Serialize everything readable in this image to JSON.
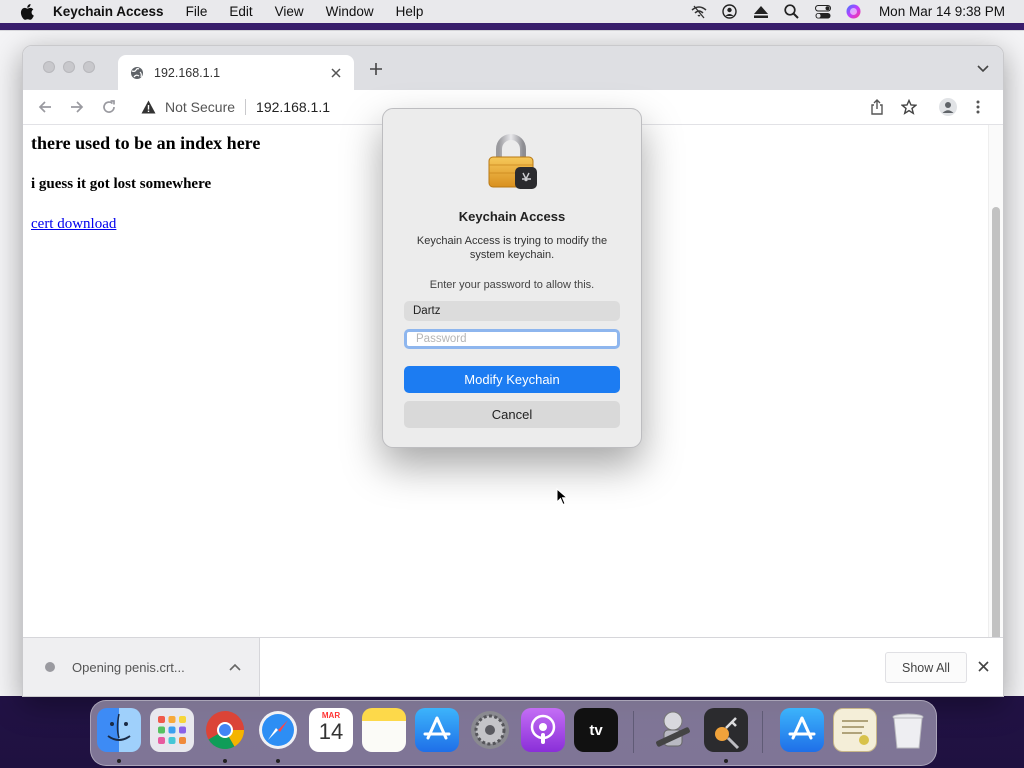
{
  "menubar": {
    "app_name": "Keychain Access",
    "items": [
      "File",
      "Edit",
      "View",
      "Window",
      "Help"
    ],
    "clock": "Mon Mar 14  9:38 PM",
    "status_icons": [
      "wifi-off-icon",
      "user-icon",
      "eject-icon",
      "spotlight-icon",
      "control-center-icon",
      "siri-icon"
    ]
  },
  "browser": {
    "tab_title": "192.168.1.1",
    "security_label": "Not Secure",
    "url": "192.168.1.1",
    "page": {
      "heading": "there used to be an index here",
      "subheading": "i guess it got lost somewhere",
      "link": "cert download"
    },
    "download": {
      "file_status": "Opening penis.crt...",
      "show_all": "Show All"
    }
  },
  "dialog": {
    "title": "Keychain Access",
    "message": "Keychain Access is trying to modify the system keychain.",
    "prompt": "Enter your password to allow this.",
    "username": "Dartz",
    "password_placeholder": "Password",
    "primary_button": "Modify Keychain",
    "secondary_button": "Cancel"
  },
  "dock": {
    "apps": [
      "Finder",
      "Launchpad",
      "Google Chrome",
      "Safari",
      "Calendar",
      "Notes",
      "App Store",
      "System Preferences",
      "Podcasts",
      "TV",
      "Automator",
      "Keychain Access",
      "Downloads",
      "Certificate",
      "Trash"
    ],
    "calendar_month": "MAR",
    "calendar_day": "14",
    "tv_label": "tv"
  },
  "colors": {
    "accent": "#1c7cf2",
    "link": "#0000ee",
    "wallpaper": "#2a1656"
  }
}
